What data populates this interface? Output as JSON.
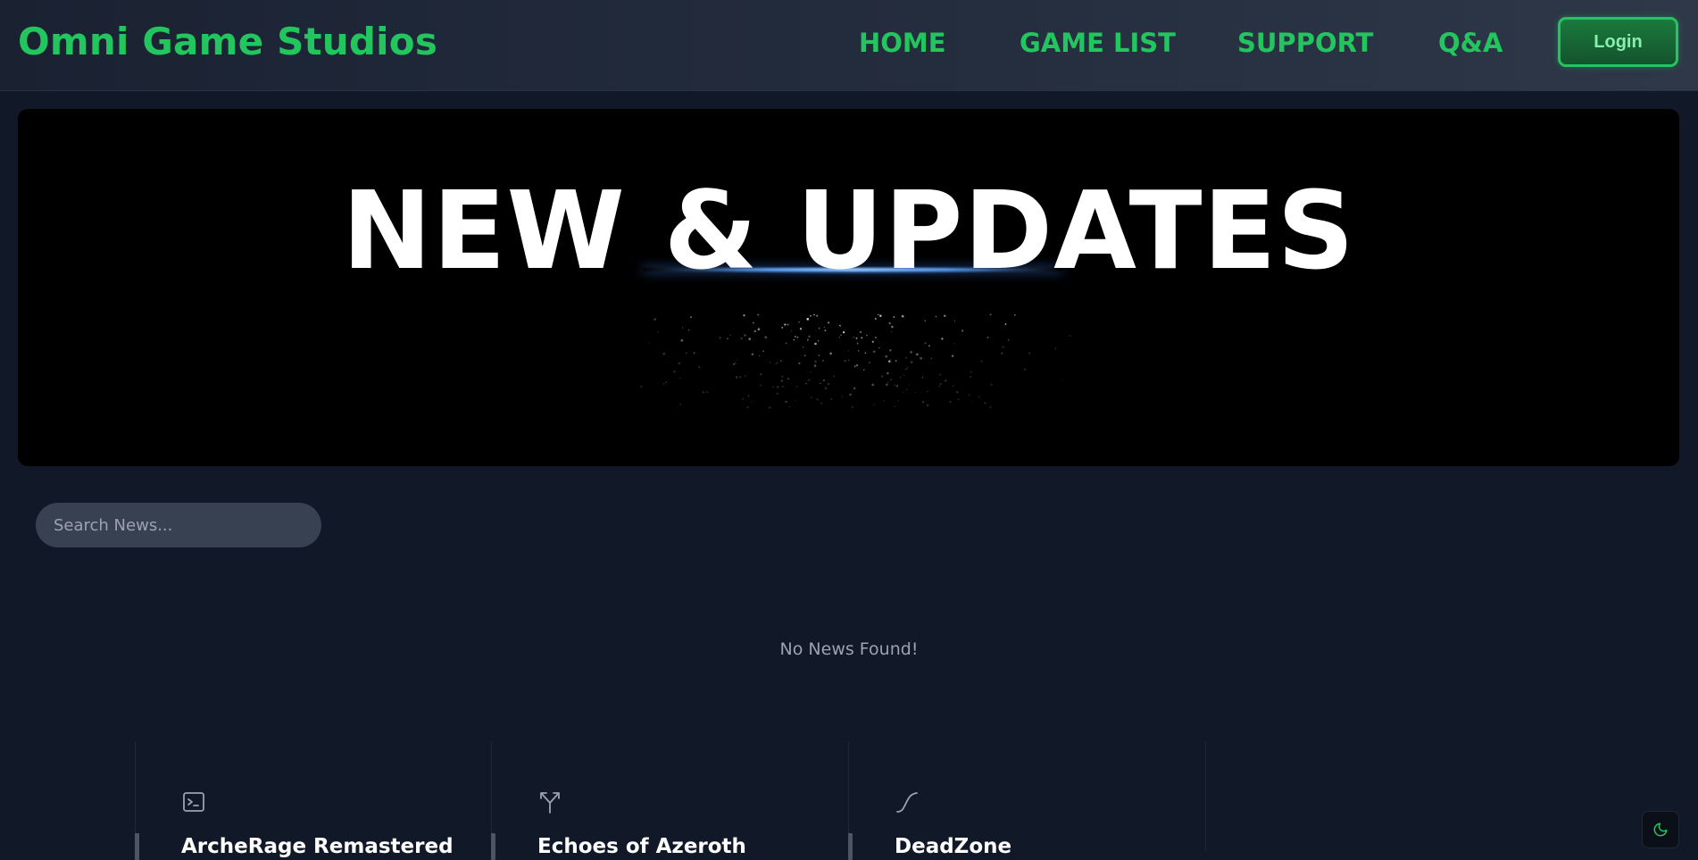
{
  "header": {
    "brand": "Omni Game Studios",
    "nav": {
      "home": "HOME",
      "games": "GAME LIST",
      "support": "SUPPORT",
      "qa": "Q&A"
    },
    "login_label": "Login"
  },
  "hero": {
    "title": "NEW & UPDATES"
  },
  "search": {
    "placeholder": "Search News..."
  },
  "news": {
    "empty_message": "No News Found!"
  },
  "cards": [
    {
      "title": "ArcheRage Remastered",
      "icon": "terminal-icon"
    },
    {
      "title": "Echoes of Azeroth",
      "icon": "split-arrows-icon"
    },
    {
      "title": "DeadZone",
      "icon": "curve-icon"
    }
  ],
  "theme_toggle": {
    "icon": "moon-icon"
  },
  "colors": {
    "accent": "#22c55e",
    "background": "#111827",
    "search_bg": "#374151"
  }
}
